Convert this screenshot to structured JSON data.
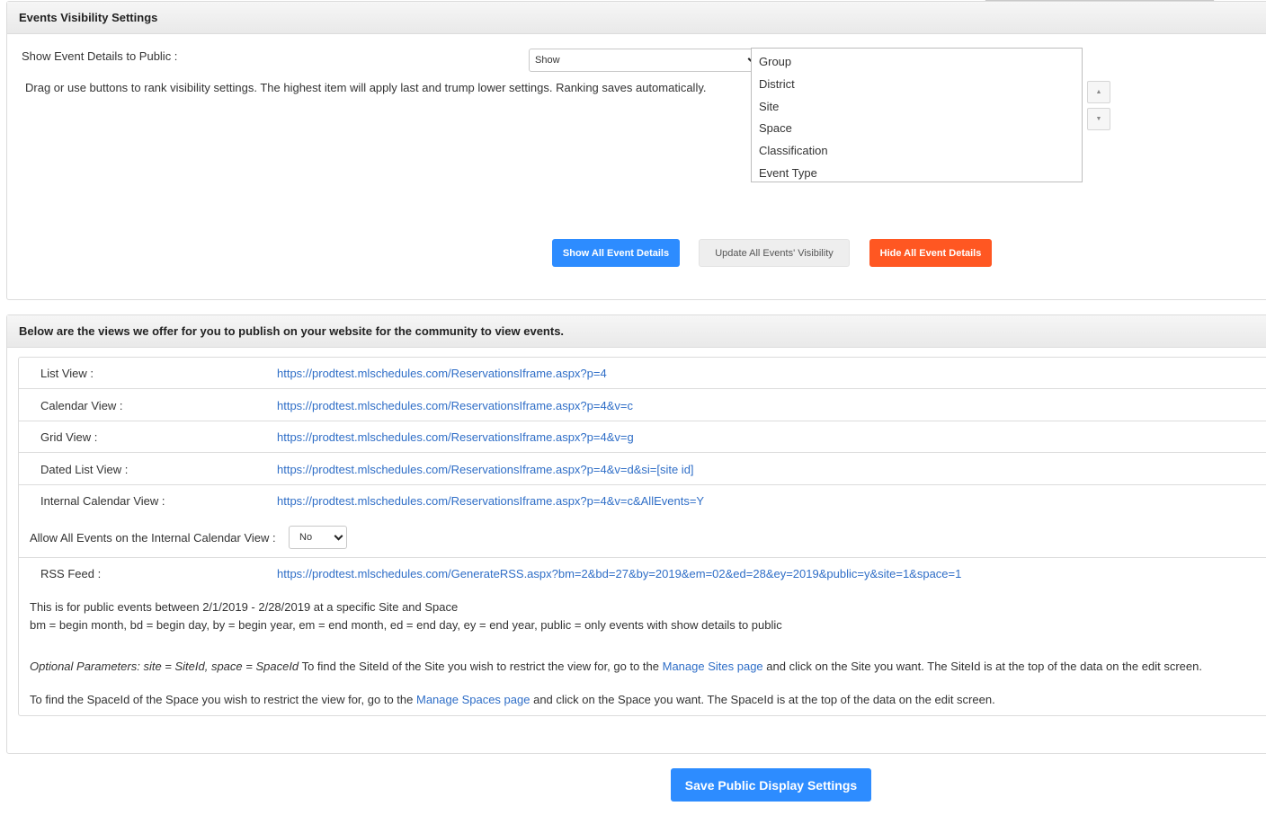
{
  "visibility_panel": {
    "title": "Events Visibility Settings",
    "show_details_label": "Show Event Details to Public :",
    "show_details_value": "Show",
    "rank_instructions": "Drag or use buttons to rank visibility settings. The highest item will apply last and trump lower settings. Ranking saves automatically.",
    "rank_items": [
      "Group",
      "District",
      "Site",
      "Space",
      "Classification",
      "Event Type"
    ],
    "move_up_glyph": "▲",
    "move_down_glyph": "▼",
    "show_all_label": "Show All Event Details",
    "update_all_label": "Update All Events' Visibility",
    "hide_all_label": "Hide All Event Details"
  },
  "views_panel": {
    "title": "Below are the views we offer for you to publish on your website for the community to view events.",
    "views": [
      {
        "label": "List View :",
        "url": "https://prodtest.mlschedules.com/ReservationsIframe.aspx?p=4"
      },
      {
        "label": "Calendar View :",
        "url": "https://prodtest.mlschedules.com/ReservationsIframe.aspx?p=4&v=c"
      },
      {
        "label": "Grid View :",
        "url": "https://prodtest.mlschedules.com/ReservationsIframe.aspx?p=4&v=g"
      },
      {
        "label": "Dated List View :",
        "url": "https://prodtest.mlschedules.com/ReservationsIframe.aspx?p=4&v=d&si=[site id]"
      },
      {
        "label": "Internal Calendar View :",
        "url": "https://prodtest.mlschedules.com/ReservationsIframe.aspx?p=4&v=c&AllEvents=Y"
      }
    ],
    "allow_all_label": "Allow All Events on the Internal Calendar View :",
    "allow_all_value": "No",
    "rss": {
      "label": "RSS Feed :",
      "url": "https://prodtest.mlschedules.com/GenerateRSS.aspx?bm=2&bd=27&by=2019&em=02&ed=28&ey=2019&public=y&site=1&space=1"
    },
    "rss_note_1": "This is for public events between 2/1/2019 - 2/28/2019 at a specific Site and Space",
    "rss_note_2": "bm = begin month, bd = begin day, by = begin year, em = end month, ed = end day, ey = end year, public = only events with show details to public",
    "optional_params": "Optional Parameters: site = SiteId, space = SpaceId",
    "site_help_pre": "To find the SiteId of the Site you wish to restrict the view for, go to the",
    "site_help_link": "Manage Sites page",
    "site_help_post": "and click on the Site you want. The SiteId is at the top of the data on the edit screen.",
    "space_help_pre": "To find the SpaceId of the Space you wish to restrict the view for, go to the",
    "space_help_link": "Manage Spaces page",
    "space_help_post": "and click on the Space you want. The SpaceId is at the top of the data on the edit screen."
  },
  "save_label": "Save Public Display Settings",
  "colors": {
    "primary_blue": "#2d8cff",
    "danger_orange": "#ff5722",
    "link_blue": "#2f6ec7"
  }
}
